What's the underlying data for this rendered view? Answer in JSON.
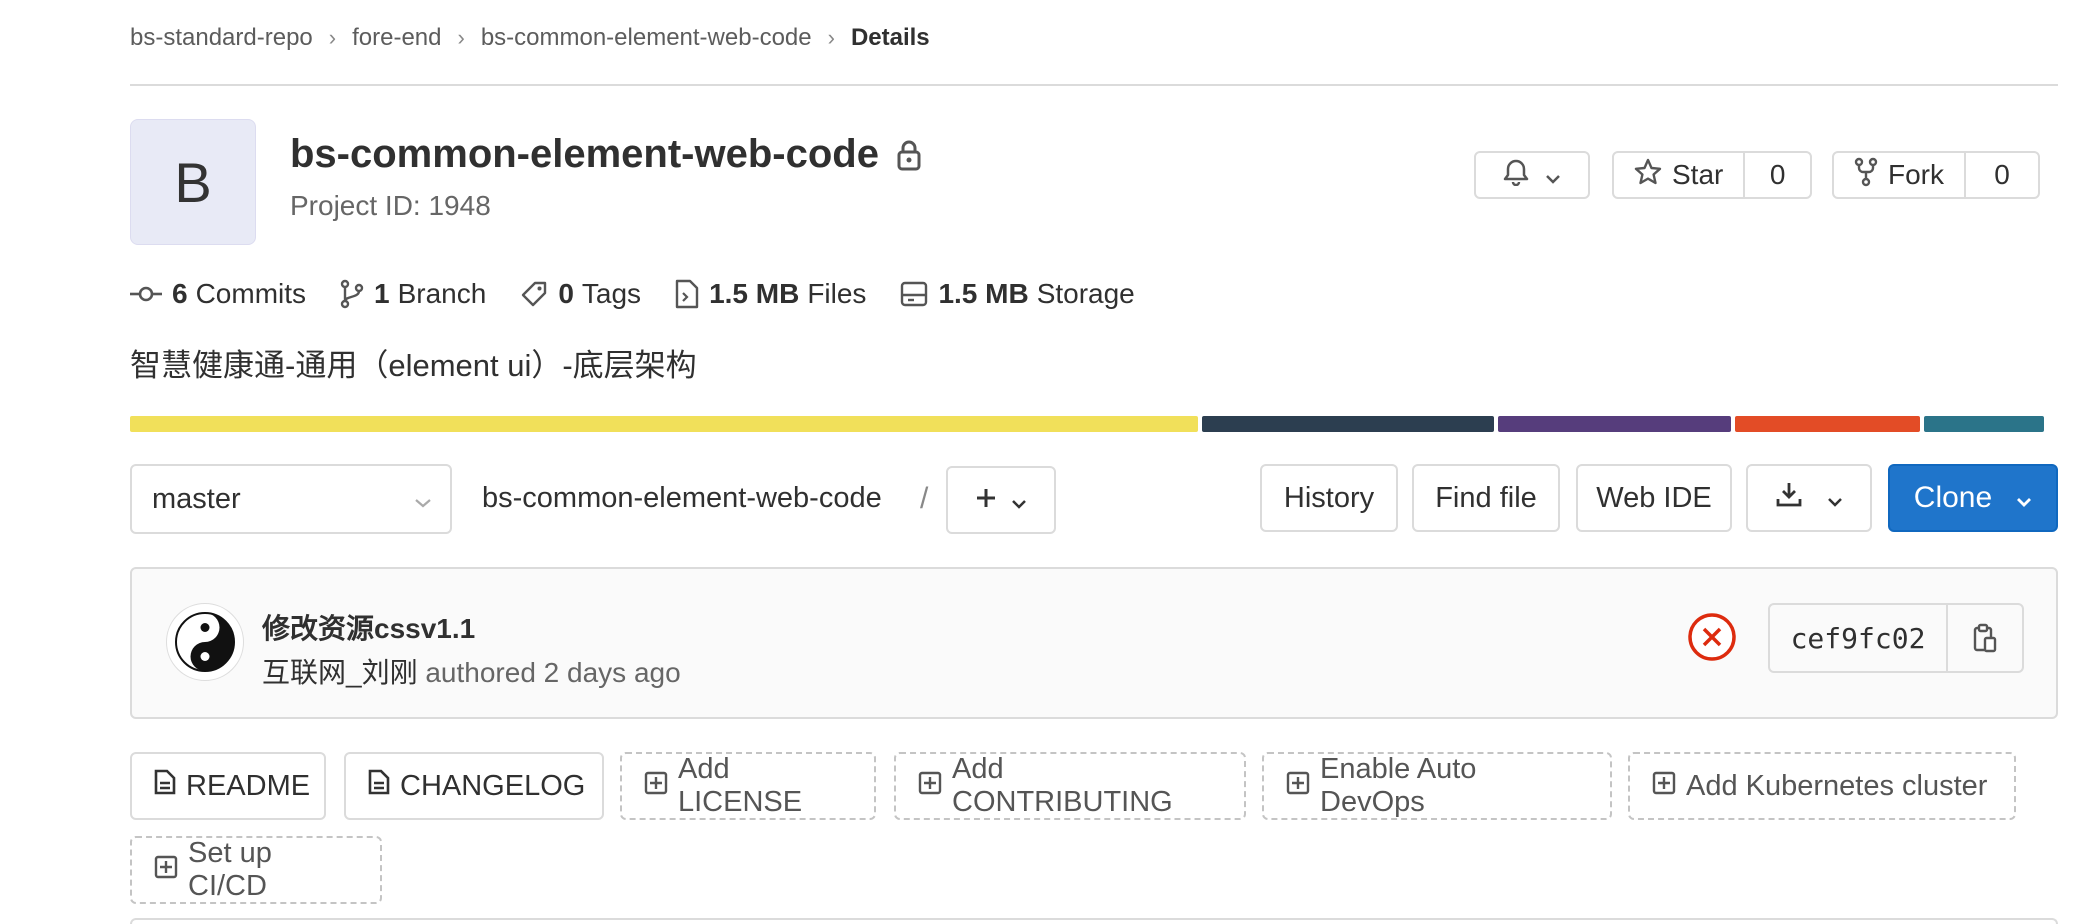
{
  "breadcrumb": {
    "items": [
      "bs-standard-repo",
      "fore-end",
      "bs-common-element-web-code"
    ],
    "current": "Details"
  },
  "project": {
    "avatar_letter": "B",
    "name": "bs-common-element-web-code",
    "id_text": "Project ID: 1948",
    "description": "智慧健康通-通用（element ui）-底层架构"
  },
  "header_actions": {
    "star_label": "Star",
    "star_count": "0",
    "fork_label": "Fork",
    "fork_count": "0"
  },
  "stats": {
    "commits_count": "6",
    "commits_label": "Commits",
    "branch_count": "1",
    "branch_label": "Branch",
    "tags_count": "0",
    "tags_label": "Tags",
    "files_size": "1.5 MB",
    "files_label": "Files",
    "storage_size": "1.5 MB",
    "storage_label": "Storage"
  },
  "languages": [
    {
      "percent": 56.0,
      "color": "#f1e05a"
    },
    {
      "percent": 15.3,
      "color": "#2c3e50"
    },
    {
      "percent": 12.2,
      "color": "#563d7c"
    },
    {
      "percent": 9.7,
      "color": "#e34c26"
    },
    {
      "percent": 6.3,
      "color": "#2b7489"
    }
  ],
  "toolbar": {
    "branch": "master",
    "path": "bs-common-element-web-code",
    "path_sep": "/",
    "history": "History",
    "find_file": "Find file",
    "web_ide": "Web IDE",
    "clone": "Clone"
  },
  "commit": {
    "title": "修改资源cssv1.1",
    "author": "互联网_刘刚",
    "meta": "authored 2 days ago",
    "sha": "cef9fc02",
    "status": "failed",
    "status_color": "#dd2b0e"
  },
  "quick_links": [
    {
      "label": "README",
      "style": "solid",
      "icon": "file-icon"
    },
    {
      "label": "CHANGELOG",
      "style": "solid",
      "icon": "file-icon"
    },
    {
      "label": "Add LICENSE",
      "style": "dashed",
      "icon": "plus-square-icon"
    },
    {
      "label": "Add CONTRIBUTING",
      "style": "dashed",
      "icon": "plus-square-icon"
    },
    {
      "label": "Enable Auto DevOps",
      "style": "dashed",
      "icon": "plus-square-icon"
    },
    {
      "label": "Add Kubernetes cluster",
      "style": "dashed",
      "icon": "plus-square-icon"
    },
    {
      "label": "Set up CI/CD",
      "style": "dashed",
      "icon": "plus-square-icon"
    }
  ],
  "colors": {
    "primary": "#1f75cb",
    "border": "#dbdbdb",
    "text": "#303030",
    "muted": "#666666"
  }
}
